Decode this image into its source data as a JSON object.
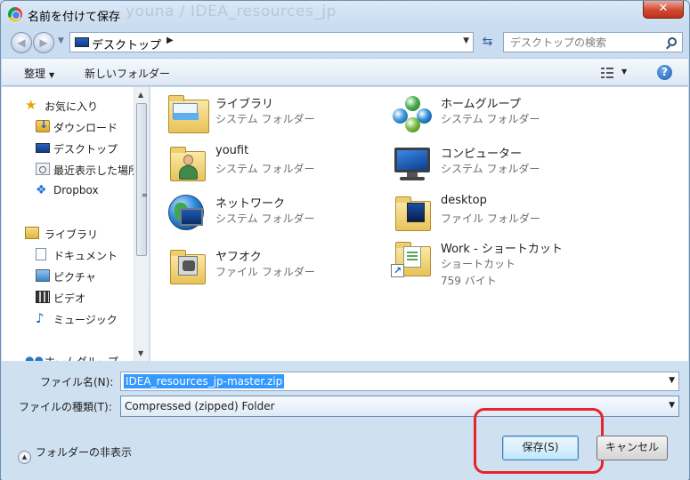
{
  "window": {
    "title": "名前を付けて保存",
    "background_title": "youna / IDEA_resources_jp",
    "close_label": "✕"
  },
  "nav": {
    "back_icon": "back-arrow-icon",
    "forward_icon": "forward-arrow-icon",
    "address": "デスクトップ",
    "address_arrow": "▶",
    "search_placeholder": "デスクトップの検索"
  },
  "toolbar": {
    "organize_label": "整理",
    "new_folder_label": "新しいフォルダー",
    "help_label": "?"
  },
  "sidebar": {
    "items": [
      {
        "label": "お気に入り",
        "icon": "star-icon"
      },
      {
        "label": "ダウンロード",
        "icon": "downloads-folder-icon"
      },
      {
        "label": "デスクトップ",
        "icon": "desktop-icon"
      },
      {
        "label": "最近表示した場所",
        "icon": "recent-places-icon"
      },
      {
        "label": "Dropbox",
        "icon": "dropbox-icon"
      },
      {
        "label": "ライブラリ",
        "icon": "library-icon"
      },
      {
        "label": "ドキュメント",
        "icon": "document-icon"
      },
      {
        "label": "ピクチャ",
        "icon": "picture-icon"
      },
      {
        "label": "ビデオ",
        "icon": "video-icon"
      },
      {
        "label": "ミュージック",
        "icon": "music-icon"
      },
      {
        "label": "ホームグループ",
        "icon": "homegroup-icon"
      }
    ]
  },
  "files": [
    {
      "name": "ライブラリ",
      "type": "システム フォルダー",
      "icon": "library-folder-icon"
    },
    {
      "name": "ホームグループ",
      "type": "システム フォルダー",
      "icon": "homegroup-icon"
    },
    {
      "name": "youfit",
      "type": "システム フォルダー",
      "icon": "user-folder-icon"
    },
    {
      "name": "コンピューター",
      "type": "システム フォルダー",
      "icon": "computer-icon"
    },
    {
      "name": "ネットワーク",
      "type": "システム フォルダー",
      "icon": "network-icon"
    },
    {
      "name": "desktop",
      "type": "ファイル フォルダー",
      "icon": "folder-icon"
    },
    {
      "name": "ヤフオク",
      "type": "ファイル フォルダー",
      "icon": "folder-icon"
    },
    {
      "name": "Work - ショートカット",
      "type": "ショートカット",
      "size": "759 バイト",
      "icon": "shortcut-icon"
    }
  ],
  "form": {
    "filename_label": "ファイル名(N):",
    "filename_value": "IDEA_resources_jp-master.zip",
    "filetype_label": "ファイルの種類(T):",
    "filetype_value": "Compressed (zipped) Folder"
  },
  "footer": {
    "hide_folders_label": "フォルダーの非表示",
    "save_label": "保存(S)",
    "cancel_label": "キャンセル"
  },
  "colors": {
    "highlight": "#e8232a",
    "selection": "#3399ff"
  }
}
